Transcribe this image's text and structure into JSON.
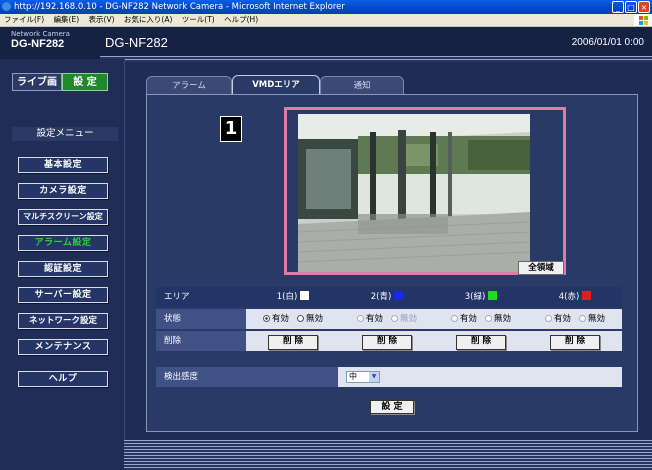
{
  "browser": {
    "title": "http://192.168.0.10 - DG-NF282 Network Camera - Microsoft Internet Explorer",
    "menu": [
      "ファイル(F)",
      "編集(E)",
      "表示(V)",
      "お気に入り(A)",
      "ツール(T)",
      "ヘルプ(H)"
    ]
  },
  "header": {
    "network_camera": "Network Camera",
    "model_short": "DG-NF282",
    "model": "DG-NF282",
    "datetime": "2006/01/01  0:00"
  },
  "mode_tabs": {
    "live": "ライブ画",
    "setup": "設 定"
  },
  "sidebar": {
    "title": "設定メニュー",
    "items": [
      {
        "label": "基本設定"
      },
      {
        "label": "カメラ設定"
      },
      {
        "label": "マルチスクリーン設定"
      },
      {
        "label": "アラーム設定"
      },
      {
        "label": "認証設定"
      },
      {
        "label": "サーバー設定"
      },
      {
        "label": "ネットワーク設定"
      },
      {
        "label": "メンテナンス"
      },
      {
        "label": "ヘルプ"
      }
    ]
  },
  "tabs": [
    {
      "label": "アラーム"
    },
    {
      "label": "VMDエリア"
    },
    {
      "label": "通知"
    }
  ],
  "callout": "1",
  "full_area_button": "全領域",
  "grid": {
    "area_label": "エリア",
    "status_label": "状態",
    "delete_label": "削除",
    "delete_button": "削 除",
    "on": "有効",
    "off": "無効",
    "areas": [
      {
        "name": "1(白)",
        "color": "#ffffff"
      },
      {
        "name": "2(青)",
        "color": "#1a28e8"
      },
      {
        "name": "3(緑)",
        "color": "#22d822"
      },
      {
        "name": "4(赤)",
        "color": "#e81a1a"
      }
    ]
  },
  "sensitivity": {
    "label": "検出感度",
    "value": "中"
  },
  "set_button": "設 定"
}
